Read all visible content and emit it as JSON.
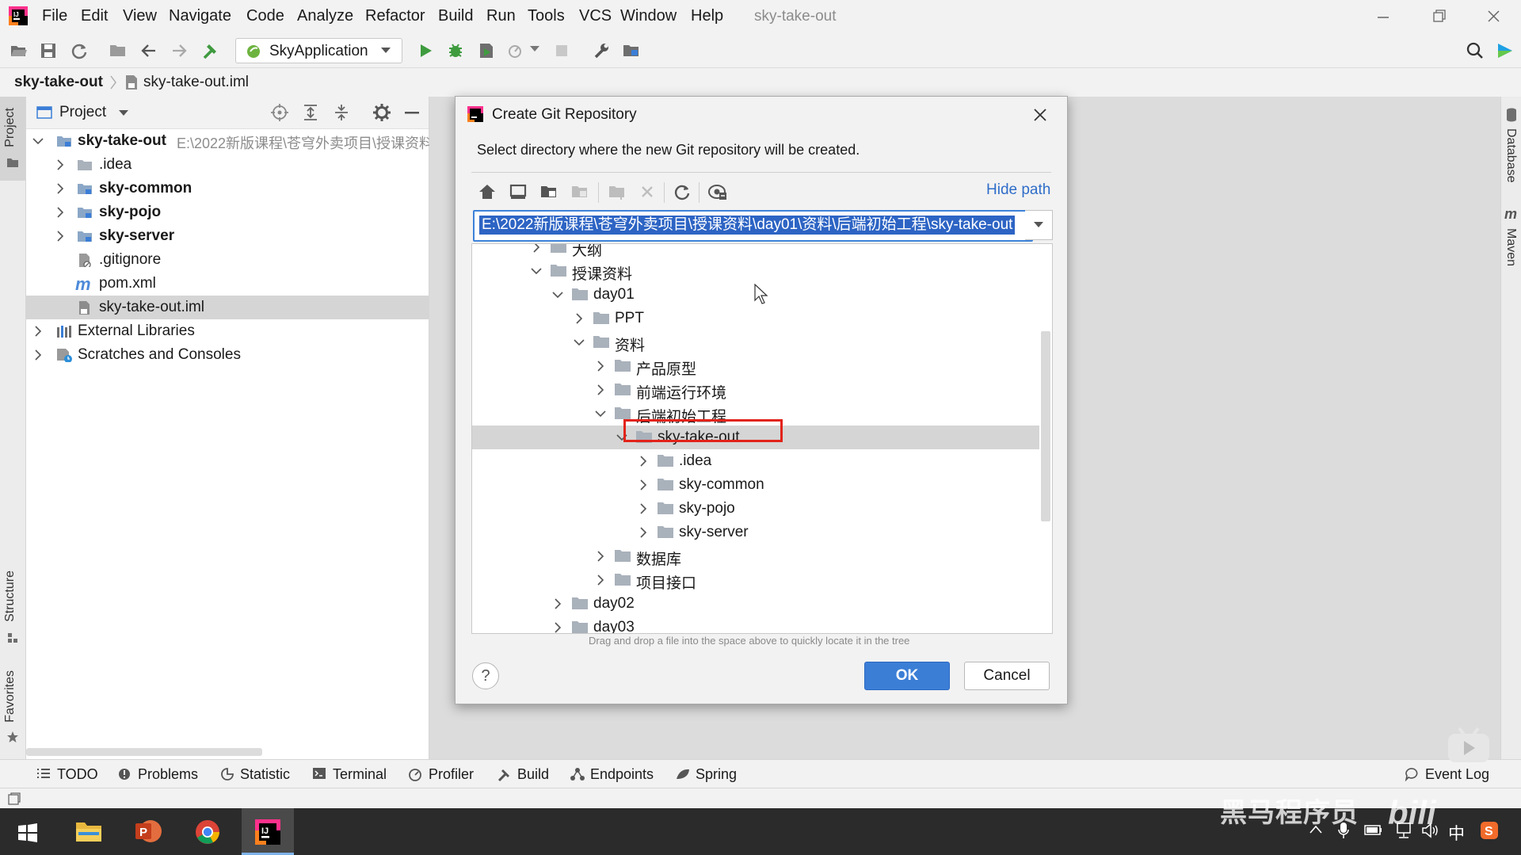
{
  "menubar": {
    "items": [
      {
        "label": "File"
      },
      {
        "label": "Edit"
      },
      {
        "label": "View"
      },
      {
        "label": "Navigate"
      },
      {
        "label": "Code"
      },
      {
        "label": "Analyze"
      },
      {
        "label": "Refactor"
      },
      {
        "label": "Build"
      },
      {
        "label": "Run"
      },
      {
        "label": "Tools"
      },
      {
        "label": "VCS"
      },
      {
        "label": "Window"
      },
      {
        "label": "Help"
      }
    ],
    "project_title": "sky-take-out"
  },
  "toolbar": {
    "run_config": "SkyApplication"
  },
  "navbar": {
    "crumbs": [
      "sky-take-out",
      "sky-take-out.iml"
    ]
  },
  "left_stripe": {
    "project": "Project",
    "structure": "Structure",
    "favorites": "Favorites"
  },
  "right_stripe": {
    "database": "Database",
    "maven": "Maven"
  },
  "project_panel": {
    "header": "Project",
    "tree": [
      {
        "label": "sky-take-out",
        "path": "E:\\2022新版课程\\苍穹外卖项目\\授课资料"
      },
      {
        "label": ".idea"
      },
      {
        "label": "sky-common"
      },
      {
        "label": "sky-pojo"
      },
      {
        "label": "sky-server"
      },
      {
        "label": ".gitignore"
      },
      {
        "label": "pom.xml"
      },
      {
        "label": "sky-take-out.iml"
      },
      {
        "label": "External Libraries"
      },
      {
        "label": "Scratches and Consoles"
      }
    ]
  },
  "dialog": {
    "title": "Create Git Repository",
    "description": "Select directory where the new Git repository will be created.",
    "hide_path": "Hide path",
    "path_value": "E:\\2022新版课程\\苍穹外卖项目\\授课资料\\day01\\资料\\后端初始工程\\sky-take-out",
    "tree": [
      {
        "label": "大纲"
      },
      {
        "label": "授课资料"
      },
      {
        "label": "day01"
      },
      {
        "label": "PPT"
      },
      {
        "label": "资料"
      },
      {
        "label": "产品原型"
      },
      {
        "label": "前端运行环境"
      },
      {
        "label": "后端初始工程"
      },
      {
        "label": "sky-take-out"
      },
      {
        "label": ".idea"
      },
      {
        "label": "sky-common"
      },
      {
        "label": "sky-pojo"
      },
      {
        "label": "sky-server"
      },
      {
        "label": "数据库"
      },
      {
        "label": "项目接口"
      },
      {
        "label": "day02"
      },
      {
        "label": "day03"
      }
    ],
    "drag_hint": "Drag and drop a file into the space above to quickly locate it in the tree",
    "help": "?",
    "ok": "OK",
    "cancel": "Cancel"
  },
  "bottom_tools": {
    "items": [
      {
        "label": "TODO"
      },
      {
        "label": "Problems"
      },
      {
        "label": "Statistic"
      },
      {
        "label": "Terminal"
      },
      {
        "label": "Profiler"
      },
      {
        "label": "Build"
      },
      {
        "label": "Endpoints"
      },
      {
        "label": "Spring"
      }
    ],
    "event_log": "Event Log"
  },
  "taskbar": {
    "ime": "中"
  },
  "watermark": "黑马程序员",
  "colors": {
    "accent": "#3b7ed6",
    "highlight": "#e2231a",
    "selection": "#2d64c4"
  }
}
